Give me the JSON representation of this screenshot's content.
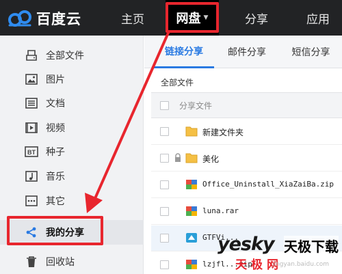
{
  "header": {
    "logo_text": "百度云",
    "nav": [
      {
        "label": "主页"
      },
      {
        "label": "网盘"
      },
      {
        "label": "分享"
      },
      {
        "label": "应用"
      }
    ]
  },
  "sidebar": {
    "items": [
      {
        "label": "全部文件",
        "icon": "drive-icon"
      },
      {
        "label": "图片",
        "icon": "image-icon"
      },
      {
        "label": "文档",
        "icon": "document-icon"
      },
      {
        "label": "视频",
        "icon": "video-icon"
      },
      {
        "label": "种子",
        "icon": "bt-icon",
        "icon_text": "BT"
      },
      {
        "label": "音乐",
        "icon": "music-icon"
      },
      {
        "label": "其它",
        "icon": "more-icon"
      },
      {
        "label": "我的分享",
        "icon": "share-icon",
        "active": true
      },
      {
        "label": "回收站",
        "icon": "trash-icon"
      }
    ]
  },
  "main": {
    "tabs": [
      {
        "label": "链接分享",
        "active": true
      },
      {
        "label": "邮件分享"
      },
      {
        "label": "短信分享"
      }
    ],
    "breadcrumb": "全部文件",
    "list_header": "分享文件",
    "rows": [
      {
        "name": "新建文件夹",
        "type": "folder"
      },
      {
        "name": "美化",
        "type": "folder",
        "locked": true
      },
      {
        "name": "Office_Uninstall_XiaZaiBa.zip",
        "type": "archive"
      },
      {
        "name": "luna.rar",
        "type": "archive"
      },
      {
        "name": "GTFVi...",
        "type": "app",
        "highlighted": true
      },
      {
        "name": "lzjfl...zip",
        "type": "archive"
      }
    ]
  },
  "watermark": {
    "brand": "yesky",
    "cn_top": "天极下载",
    "cn_bottom": "天极网",
    "url": "jingyan.baidu.com"
  },
  "colors": {
    "topbar": "#222325",
    "accent_blue": "#2a7ae2",
    "annotation_red": "#e8262e",
    "sidebar_bg": "#f1f2f4"
  }
}
